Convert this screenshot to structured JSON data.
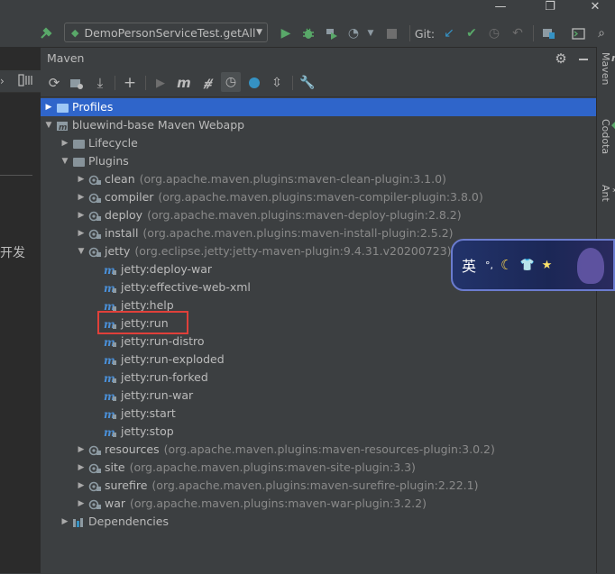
{
  "window": {
    "minimize": "—",
    "restore": "❐",
    "close": "✕"
  },
  "runbar": {
    "config_label": "DemoPersonServiceTest.getAll",
    "git_label": "Git:"
  },
  "left": {
    "partial_text": "开发"
  },
  "maven": {
    "title": "Maven",
    "tree": [
      {
        "label": "Profiles",
        "indent": 0,
        "expanded": false,
        "selected": true,
        "icon": "folder-icon"
      },
      {
        "label": "bluewind-base Maven Webapp",
        "indent": 0,
        "expanded": true,
        "icon": "maven-project-icon"
      },
      {
        "label": "Lifecycle",
        "indent": 1,
        "expanded": false,
        "icon": "folder-icon"
      },
      {
        "label": "Plugins",
        "indent": 1,
        "expanded": true,
        "icon": "folder-icon"
      },
      {
        "label": "clean",
        "detail": "(org.apache.maven.plugins:maven-clean-plugin:3.1.0)",
        "indent": 2,
        "expanded": false,
        "icon": "plugin-icon"
      },
      {
        "label": "compiler",
        "detail": "(org.apache.maven.plugins:maven-compiler-plugin:3.8.0)",
        "indent": 2,
        "expanded": false,
        "icon": "plugin-icon"
      },
      {
        "label": "deploy",
        "detail": "(org.apache.maven.plugins:maven-deploy-plugin:2.8.2)",
        "indent": 2,
        "expanded": false,
        "icon": "plugin-icon"
      },
      {
        "label": "install",
        "detail": "(org.apache.maven.plugins:maven-install-plugin:2.5.2)",
        "indent": 2,
        "expanded": false,
        "icon": "plugin-icon"
      },
      {
        "label": "jetty",
        "detail": "(org.eclipse.jetty:jetty-maven-plugin:9.4.31.v20200723)",
        "indent": 2,
        "expanded": true,
        "icon": "plugin-icon"
      },
      {
        "label": "jetty:deploy-war",
        "indent": 3,
        "icon": "goal-icon"
      },
      {
        "label": "jetty:effective-web-xml",
        "indent": 3,
        "icon": "goal-icon"
      },
      {
        "label": "jetty:help",
        "indent": 3,
        "icon": "goal-icon"
      },
      {
        "label": "jetty:run",
        "indent": 3,
        "icon": "goal-icon"
      },
      {
        "label": "jetty:run-distro",
        "indent": 3,
        "icon": "goal-icon"
      },
      {
        "label": "jetty:run-exploded",
        "indent": 3,
        "icon": "goal-icon"
      },
      {
        "label": "jetty:run-forked",
        "indent": 3,
        "icon": "goal-icon"
      },
      {
        "label": "jetty:run-war",
        "indent": 3,
        "icon": "goal-icon"
      },
      {
        "label": "jetty:start",
        "indent": 3,
        "icon": "goal-icon"
      },
      {
        "label": "jetty:stop",
        "indent": 3,
        "icon": "goal-icon"
      },
      {
        "label": "resources",
        "detail": "(org.apache.maven.plugins:maven-resources-plugin:3.0.2)",
        "indent": 2,
        "expanded": false,
        "icon": "plugin-icon"
      },
      {
        "label": "site",
        "detail": "(org.apache.maven.plugins:maven-site-plugin:3.3)",
        "indent": 2,
        "expanded": false,
        "icon": "plugin-icon"
      },
      {
        "label": "surefire",
        "detail": "(org.apache.maven.plugins:maven-surefire-plugin:2.22.1)",
        "indent": 2,
        "expanded": false,
        "icon": "plugin-icon"
      },
      {
        "label": "war",
        "detail": "(org.apache.maven.plugins:maven-war-plugin:3.2.2)",
        "indent": 2,
        "expanded": false,
        "icon": "plugin-icon"
      },
      {
        "label": "Dependencies",
        "indent": 1,
        "expanded": false,
        "icon": "dependencies-icon"
      }
    ]
  },
  "right_stripe": {
    "maven": "Maven",
    "codota": "Codota",
    "ant": "Ant"
  },
  "ime": {
    "mode": "英",
    "punct": "°,",
    "moon": "☾",
    "shirt": "👕",
    "star": "★"
  },
  "colors": {
    "selection": "#2f65ca",
    "highlight_box": "#e0403a"
  }
}
